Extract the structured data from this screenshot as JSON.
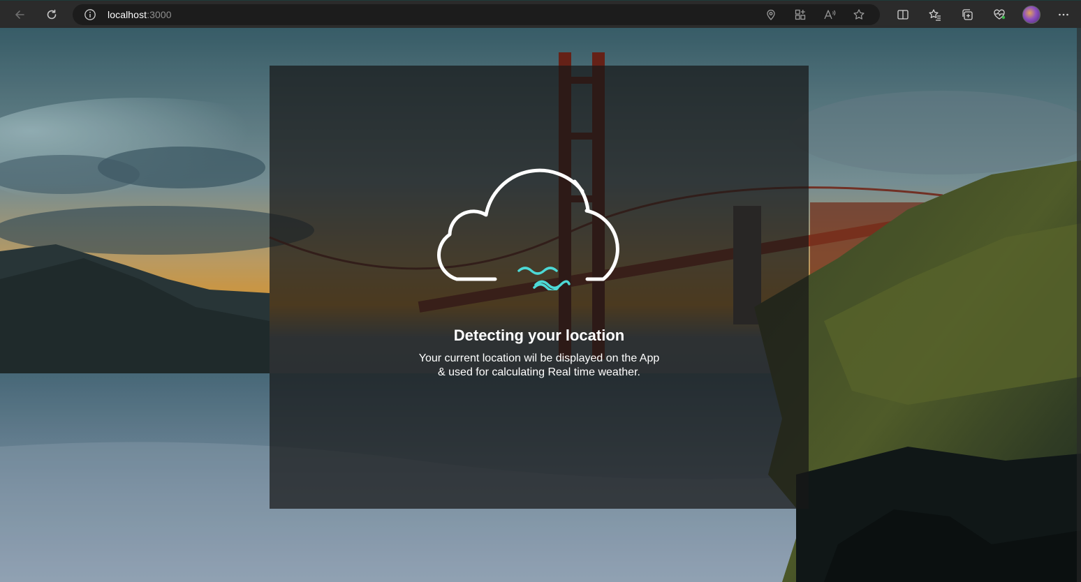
{
  "browser": {
    "url_host": "localhost",
    "url_port": ":3000",
    "icons": {
      "back": "back-arrow-icon",
      "refresh": "refresh-icon",
      "site_info": "info-icon",
      "location": "location-pin-icon",
      "apps": "apps-grid-icon",
      "read_aloud": "read-aloud-icon",
      "favorite": "star-icon",
      "split_screen": "split-screen-icon",
      "favorites": "favorites-list-icon",
      "collections": "collections-icon",
      "browser_essentials": "heart-pulse-icon",
      "profile": "profile-avatar",
      "more": "more-dots-icon"
    }
  },
  "page": {
    "title": "Detecting your location",
    "description_line1": "Your current location wil be displayed on the App",
    "description_line2": "& used for calculating Real time weather.",
    "icon": "cloud-wind-icon"
  },
  "colors": {
    "accent_wind": "#4dd9d6",
    "cloud_outline": "#ffffff",
    "card_overlay": "rgba(24,24,24,0.72)"
  }
}
